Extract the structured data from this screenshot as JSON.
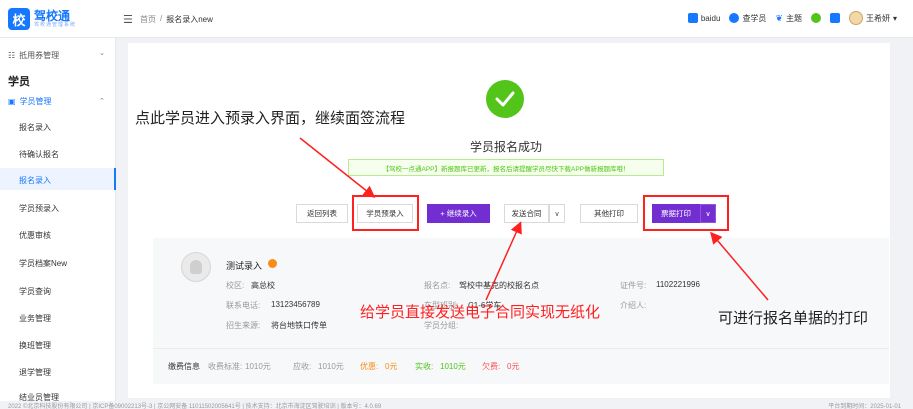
{
  "header": {
    "logo_badge": "校",
    "logo_title": "驾校通",
    "logo_subtitle": "驾校通管理系统",
    "menu_icon": "hamburger-icon",
    "breadcrumb": {
      "home": "首页",
      "sep": "/",
      "current": "报名录入new"
    },
    "right_items": [
      {
        "label": "baidu",
        "icon": "baidu-icon",
        "color": "#1677ff"
      },
      {
        "label": "查学员",
        "icon": "search-student-icon",
        "color": "#1677ff"
      },
      {
        "label": "主题",
        "icon": "theme-icon",
        "color": "#1677ff"
      },
      {
        "label": "",
        "icon": "refresh-icon",
        "color": "#52c41a"
      },
      {
        "label": "",
        "icon": "screen-icon",
        "color": "#1677ff"
      }
    ],
    "user_name": "王希妍",
    "user_caret": "▾"
  },
  "sidebar": {
    "group_top": "抵用券管理",
    "group_top_caret": "⌄",
    "heading": "学员",
    "sub_group": "学员管理",
    "sub_group_caret": "⌃",
    "items": [
      "报名录入",
      "待确认报名",
      "报名录入",
      "学员预录入",
      "优惠审核",
      "学员档案New",
      "学员查询",
      "业务管理",
      "换班管理",
      "退学管理",
      "结业员管理"
    ],
    "active_index": 2
  },
  "main": {
    "success_title": "学员报名成功",
    "notice": "【驾校一点通APP】新报题库已更新，报名后请提醒学员尽快下载APP做新报题库哦！",
    "buttons": {
      "back": "返回列表",
      "pre_entry": "学员预录入",
      "continue_entry": "+ 继续录入",
      "send_contract": "发送合同",
      "other_print": "其他打印",
      "receipt_print": "票据打印",
      "caret": "∨"
    },
    "student": {
      "name": "测试录入",
      "school_label": "校区:",
      "school": "高总校",
      "phone_label": "联系电话:",
      "phone": "13123456789",
      "source_label": "招生来源:",
      "source": "将台地铁口传单",
      "signup_point_label": "报名点:",
      "signup_point": "驾校中基克的校报名点",
      "class_label": "车型班别:",
      "class": "C1-6学车",
      "group_label": "学员分组:",
      "group": "",
      "id_label": "证件号:",
      "id": "1102221996",
      "introducer_label": "介绍人:",
      "introducer": ""
    },
    "fees": {
      "title": "缴费信息",
      "standard_label": "收费标准:",
      "standard": "1010元",
      "receivable_label": "应收:",
      "receivable": "1010元",
      "discount_label": "优惠:",
      "discount": "0元",
      "received_label": "实收:",
      "received": "1010元",
      "owed_label": "欠费:",
      "owed": "0元"
    }
  },
  "annotations": {
    "pre_entry_note": "点此学员进入预录入界面，继续面签流程",
    "contract_note": "给学员直接发送电子合同实现无纸化",
    "print_note": "可进行报名单据的打印",
    "color": "#ff2020"
  },
  "footer": {
    "left": "2022 ©北京科技股份有限公司 | 京ICP备09002213号-3 | 京公网安备 11011502005641号 | 技术支持：北京市海淀区驾驶培训 | 版本号：4.0.69",
    "right": "平台到期时间：2025-01-01"
  },
  "colors": {
    "primary": "#1677ff",
    "success": "#52c41a",
    "purple": "#722ed1",
    "danger": "#ff2020",
    "orange": "#fa8c16"
  }
}
